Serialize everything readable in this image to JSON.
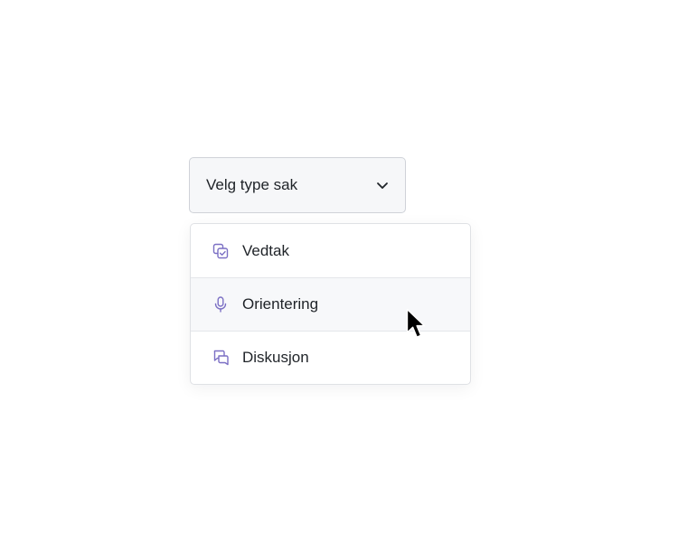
{
  "select": {
    "value": "Velg type sak",
    "chevron_icon": "chevron-down-icon"
  },
  "menu": {
    "items": [
      {
        "label": "Vedtak",
        "icon": "copy-check-icon",
        "hovered": false
      },
      {
        "label": "Orientering",
        "icon": "microphone-icon",
        "hovered": true
      },
      {
        "label": "Diskusjon",
        "icon": "chat-bubbles-icon",
        "hovered": false
      }
    ]
  },
  "colors": {
    "icon_accent": "#7b6fc4",
    "text": "#1f2328",
    "trigger_bg": "#f6f7f9",
    "hover_bg": "#f7f8fa"
  }
}
